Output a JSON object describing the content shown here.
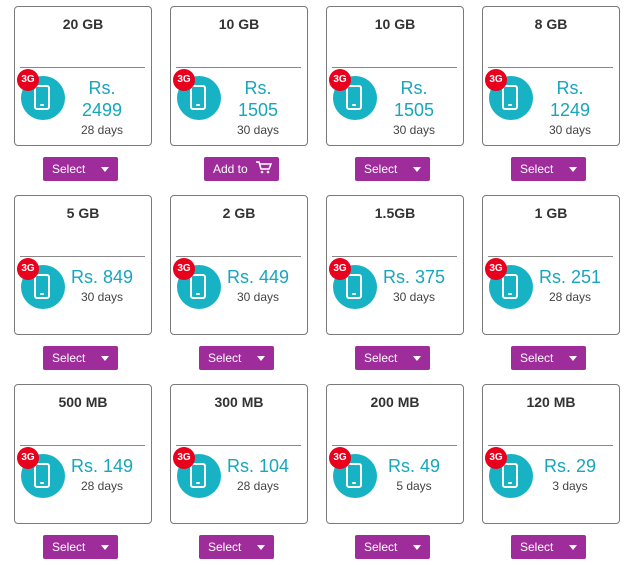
{
  "plans": [
    {
      "size": "20 GB",
      "price_line1": "Rs.",
      "price_line2": "2499",
      "days": "28 days",
      "badge": "3G",
      "button": "Select"
    },
    {
      "size": "10 GB",
      "price_line1": "Rs.",
      "price_line2": "1505",
      "days": "30 days",
      "badge": "3G",
      "button": "Add to"
    },
    {
      "size": "10 GB",
      "price_line1": "Rs.",
      "price_line2": "1505",
      "days": "30 days",
      "badge": "3G",
      "button": "Select"
    },
    {
      "size": "8 GB",
      "price_line1": "Rs.",
      "price_line2": "1249",
      "days": "30 days",
      "badge": "3G",
      "button": "Select"
    },
    {
      "size": "5 GB",
      "price": "Rs. 849",
      "days": "30 days",
      "badge": "3G",
      "button": "Select"
    },
    {
      "size": "2 GB",
      "price": "Rs. 449",
      "days": "30 days",
      "badge": "3G",
      "button": "Select"
    },
    {
      "size": "1.5GB",
      "price": "Rs. 375",
      "days": "30 days",
      "badge": "3G",
      "button": "Select"
    },
    {
      "size": "1 GB",
      "price": "Rs. 251",
      "days": "28 days",
      "badge": "3G",
      "button": "Select"
    },
    {
      "size": "500 MB",
      "price": "Rs. 149",
      "days": "28 days",
      "badge": "3G",
      "button": "Select"
    },
    {
      "size": "300 MB",
      "price": "Rs. 104",
      "days": "28 days",
      "badge": "3G",
      "button": "Select"
    },
    {
      "size": "200 MB",
      "price": "Rs. 49",
      "days": "5 days",
      "badge": "3G",
      "button": "Select"
    },
    {
      "size": "120 MB",
      "price": "Rs. 29",
      "days": "3 days",
      "badge": "3G",
      "button": "Select"
    }
  ],
  "colors": {
    "accent": "#9f2c9b",
    "price": "#17a6bd",
    "badge": "#e8001d",
    "circle": "#17b2c4"
  },
  "icons": {
    "phone": "mobile-phone-icon",
    "cart": "shopping-cart-icon",
    "caret": "chevron-down-icon"
  }
}
